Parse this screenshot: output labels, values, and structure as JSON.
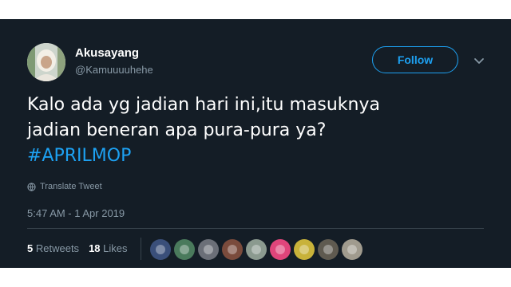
{
  "user": {
    "display_name": "Akusayang",
    "handle": "@Kamuuuuhehe"
  },
  "follow_label": "Follow",
  "tweet": {
    "line1": "Kalo ada yg jadian hari ini,itu masuknya",
    "line2": "jadian beneran apa pura-pura ya?",
    "hashtag": "#APRILMOP"
  },
  "translate_label": "Translate Tweet",
  "timestamp": "5:47 AM - 1 Apr 2019",
  "stats": {
    "retweets_count": "5",
    "retweets_label": "Retweets",
    "likes_count": "18",
    "likes_label": "Likes"
  },
  "colors": {
    "background": "#141d26",
    "accent": "#1da1f2",
    "secondary_text": "#8899a6",
    "divider": "#38444d"
  },
  "icons": [
    "globe-icon",
    "chevron-down-icon"
  ],
  "likers": [
    {
      "name": "liker-1",
      "color": "#3a4f7a"
    },
    {
      "name": "liker-2",
      "color": "#4a7a5c"
    },
    {
      "name": "liker-3",
      "color": "#6b6f78"
    },
    {
      "name": "liker-4",
      "color": "#7a4b3c"
    },
    {
      "name": "liker-5",
      "color": "#8b9a8f"
    },
    {
      "name": "liker-6",
      "color": "#e0457b"
    },
    {
      "name": "liker-7",
      "color": "#c8b23a"
    },
    {
      "name": "liker-8",
      "color": "#5f5a50"
    },
    {
      "name": "liker-9",
      "color": "#a09b8e"
    }
  ]
}
